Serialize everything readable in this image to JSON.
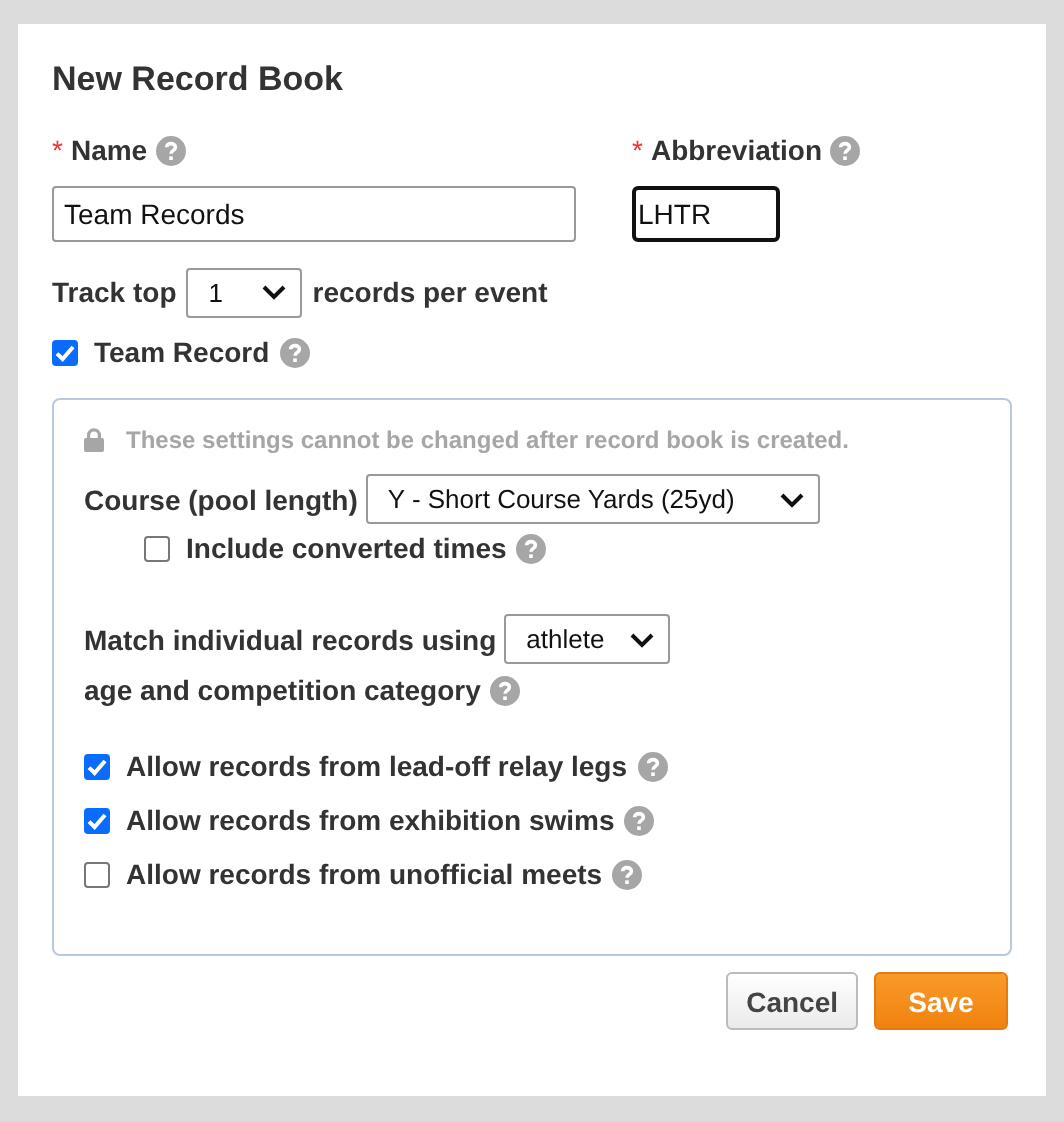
{
  "dialog": {
    "title": "New Record Book"
  },
  "name_field": {
    "required_mark": "*",
    "label": "Name",
    "value": "Team Records",
    "focused": false
  },
  "abbreviation_field": {
    "required_mark": "*",
    "label": "Abbreviation",
    "value": "LHTR",
    "focused": true
  },
  "track_top": {
    "label_before": "Track top",
    "value": "1",
    "label_after": "records per event"
  },
  "team_record": {
    "label": "Team Record",
    "checked": true
  },
  "locked_settings": {
    "notice": "These settings cannot be changed after record book is created.",
    "course": {
      "label": "Course (pool length)",
      "value": "Y - Short Course Yards (25yd)"
    },
    "include_converted": {
      "label": "Include converted times",
      "checked": false
    },
    "match": {
      "label_before": "Match individual records using",
      "value": "athlete",
      "label_after": "age and competition category"
    },
    "options": [
      {
        "label": "Allow records from lead-off relay legs",
        "checked": true
      },
      {
        "label": "Allow records from exhibition swims",
        "checked": true
      },
      {
        "label": "Allow records from unofficial meets",
        "checked": false
      }
    ]
  },
  "buttons": [
    {
      "label": "Cancel",
      "kind": "secondary"
    },
    {
      "label": "Save",
      "kind": "primary"
    }
  ]
}
